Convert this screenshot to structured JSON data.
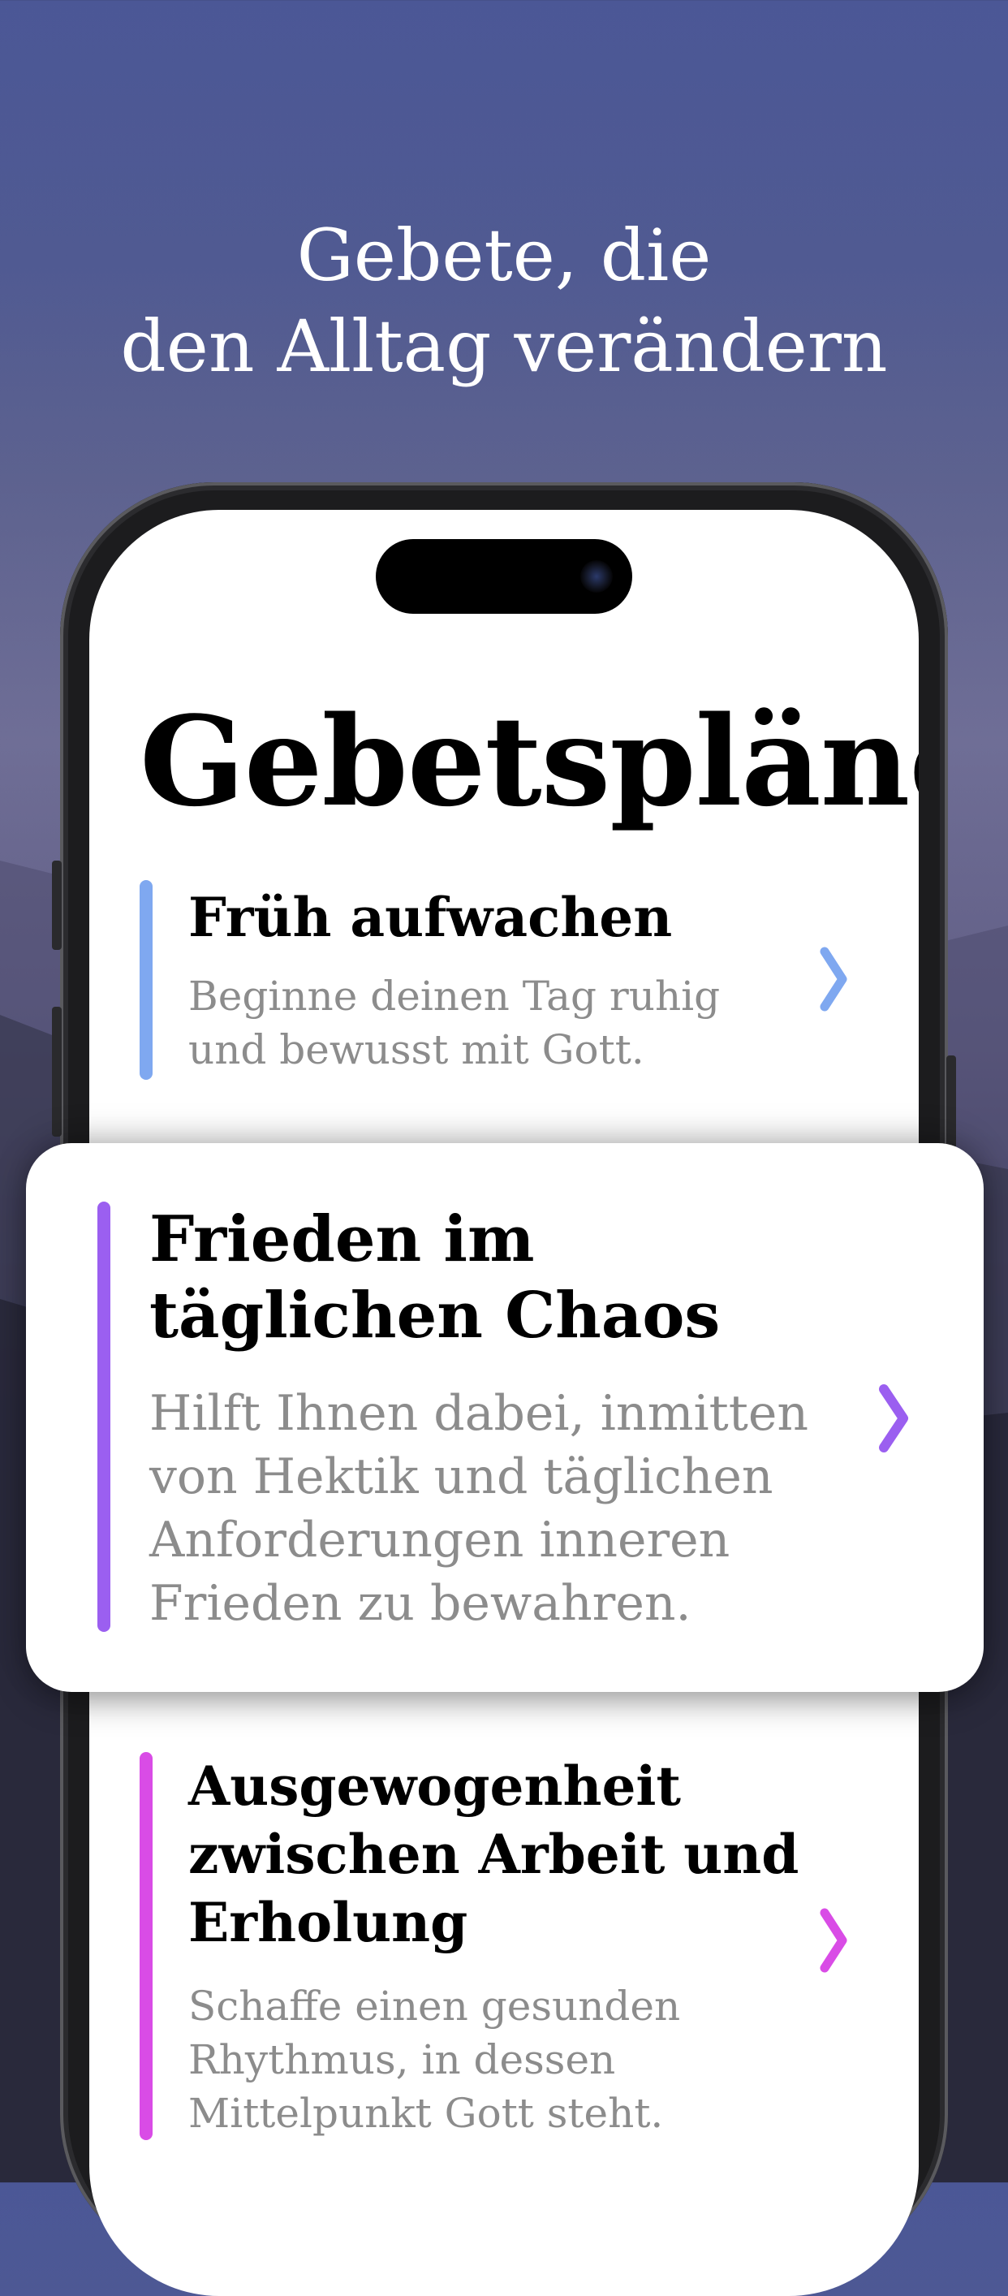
{
  "headline": {
    "line1": "Gebete, die",
    "line2": "den Alltag verändern"
  },
  "screen": {
    "title": "Gebetspläne"
  },
  "plans": [
    {
      "title": "Früh aufwachen",
      "description": "Beginne deinen Tag ruhig und bewusst mit Gott.",
      "accent": "#7fa8f0",
      "icon": "chevron-right-icon"
    },
    {
      "title": "Frieden im täglichen Chaos",
      "description": "Hilft Ihnen dabei, inmitten von Hektik und täglichen Anforderungen inneren Frieden zu bewahren.",
      "accent": "#9b5ff0",
      "icon": "chevron-right-icon"
    },
    {
      "title": "Ausgewogenheit zwischen Arbeit und Erholung",
      "description": "Schaffe einen gesunden Rhythmus, in dessen Mittelpunkt Gott steht.",
      "accent": "#d94ce6",
      "icon": "chevron-right-icon"
    }
  ],
  "colors": {
    "background_top": "#4b5796",
    "background_bottom": "#1f1f2d",
    "card": "#ffffff",
    "description_text": "#8c8c8c"
  }
}
